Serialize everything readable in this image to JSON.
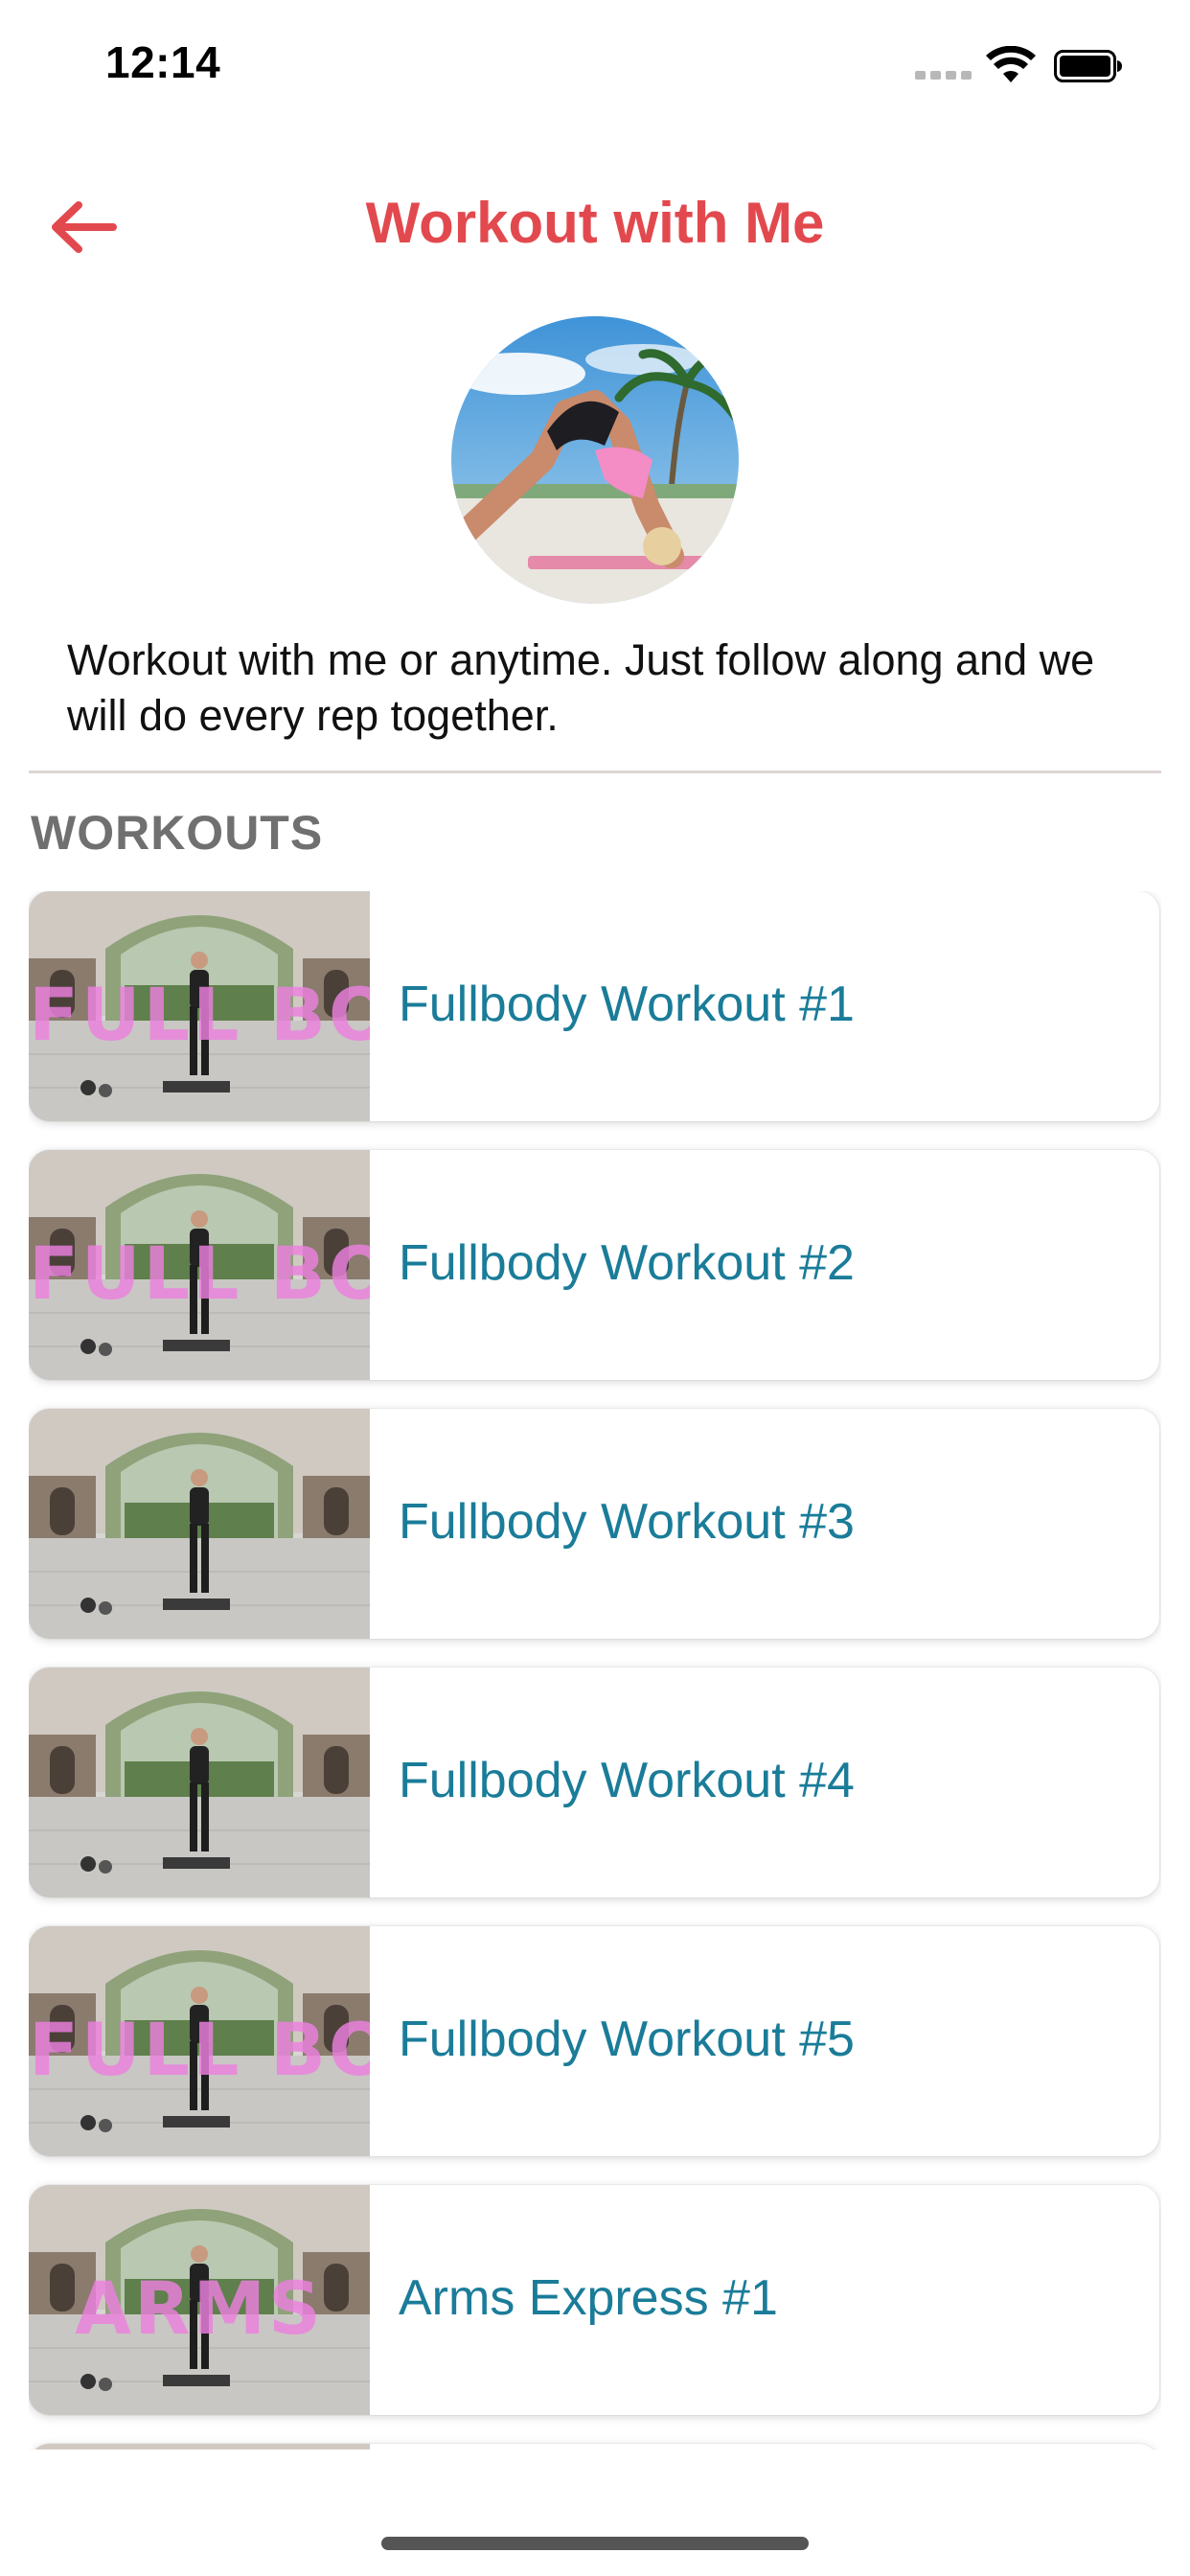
{
  "status_bar": {
    "time": "12:14"
  },
  "nav": {
    "title": "Workout with Me",
    "back_icon": "arrow-left-icon"
  },
  "colors": {
    "accent": "#e2494e",
    "link": "#1a7c99",
    "section": "#707070",
    "overlay": "#ec80de"
  },
  "intro": {
    "text": "Workout with me or anytime. Just follow along and we will do every rep together."
  },
  "section": {
    "title": "WORKOUTS"
  },
  "workouts": [
    {
      "title": "Fullbody Workout #1",
      "overlay": "FULL BODY"
    },
    {
      "title": "Fullbody Workout #2",
      "overlay": "FULL BODY"
    },
    {
      "title": "Fullbody Workout #3",
      "overlay": ""
    },
    {
      "title": "Fullbody Workout #4",
      "overlay": ""
    },
    {
      "title": "Fullbody Workout #5",
      "overlay": "FULL BODY"
    },
    {
      "title": "Arms Express #1",
      "overlay": "ARMS"
    },
    {
      "title": "",
      "overlay": ""
    }
  ]
}
